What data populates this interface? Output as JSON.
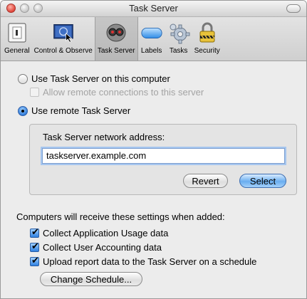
{
  "window": {
    "title": "Task Server"
  },
  "toolbar": {
    "items": [
      {
        "label": "General",
        "icon": "general-icon"
      },
      {
        "label": "Control & Observe",
        "icon": "screen-icon"
      },
      {
        "label": "Task Server",
        "icon": "task-server-icon",
        "selected": true
      },
      {
        "label": "Labels",
        "icon": "label-icon"
      },
      {
        "label": "Tasks",
        "icon": "gear-icon"
      },
      {
        "label": "Security",
        "icon": "lock-icon"
      }
    ]
  },
  "server_mode": {
    "local_label": "Use Task Server on this computer",
    "local_selected": false,
    "allow_remote_label": "Allow remote connections to this server",
    "allow_remote_checked": false,
    "allow_remote_enabled": false,
    "remote_label": "Use remote Task Server",
    "remote_selected": true
  },
  "remote_box": {
    "address_label": "Task Server network address:",
    "address_value": "taskserver.example.com",
    "revert_label": "Revert",
    "select_label": "Select"
  },
  "defaults": {
    "heading": "Computers will receive these settings when added:",
    "options": [
      {
        "label": "Collect Application Usage data",
        "checked": true
      },
      {
        "label": "Collect User Accounting data",
        "checked": true
      },
      {
        "label": "Upload report data to the Task Server on a schedule",
        "checked": true
      }
    ],
    "schedule_button": "Change Schedule..."
  },
  "colors": {
    "accent": "#2b78d8",
    "window_bg": "#ececec"
  }
}
